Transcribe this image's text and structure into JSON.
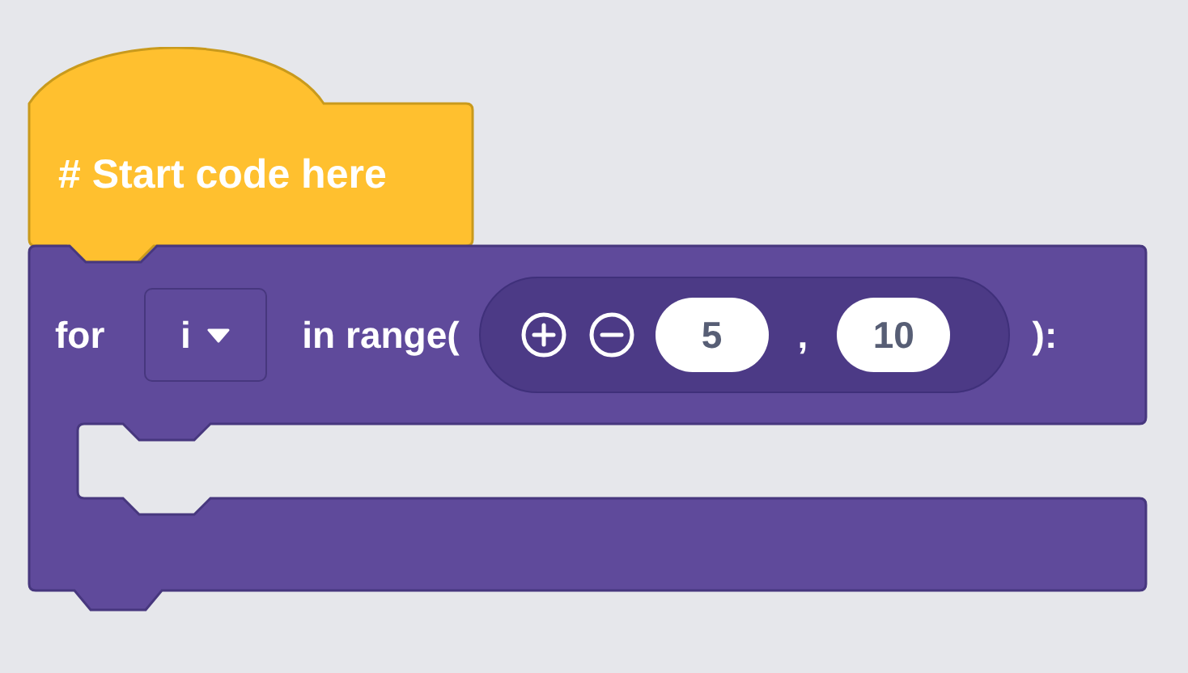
{
  "hat_block": {
    "label": "# Start code here"
  },
  "for_block": {
    "keyword": "for",
    "variable": {
      "value": "i"
    },
    "range_label": "in range(",
    "arguments": [
      "5",
      "10"
    ],
    "separator": ",",
    "closing": "):"
  }
}
